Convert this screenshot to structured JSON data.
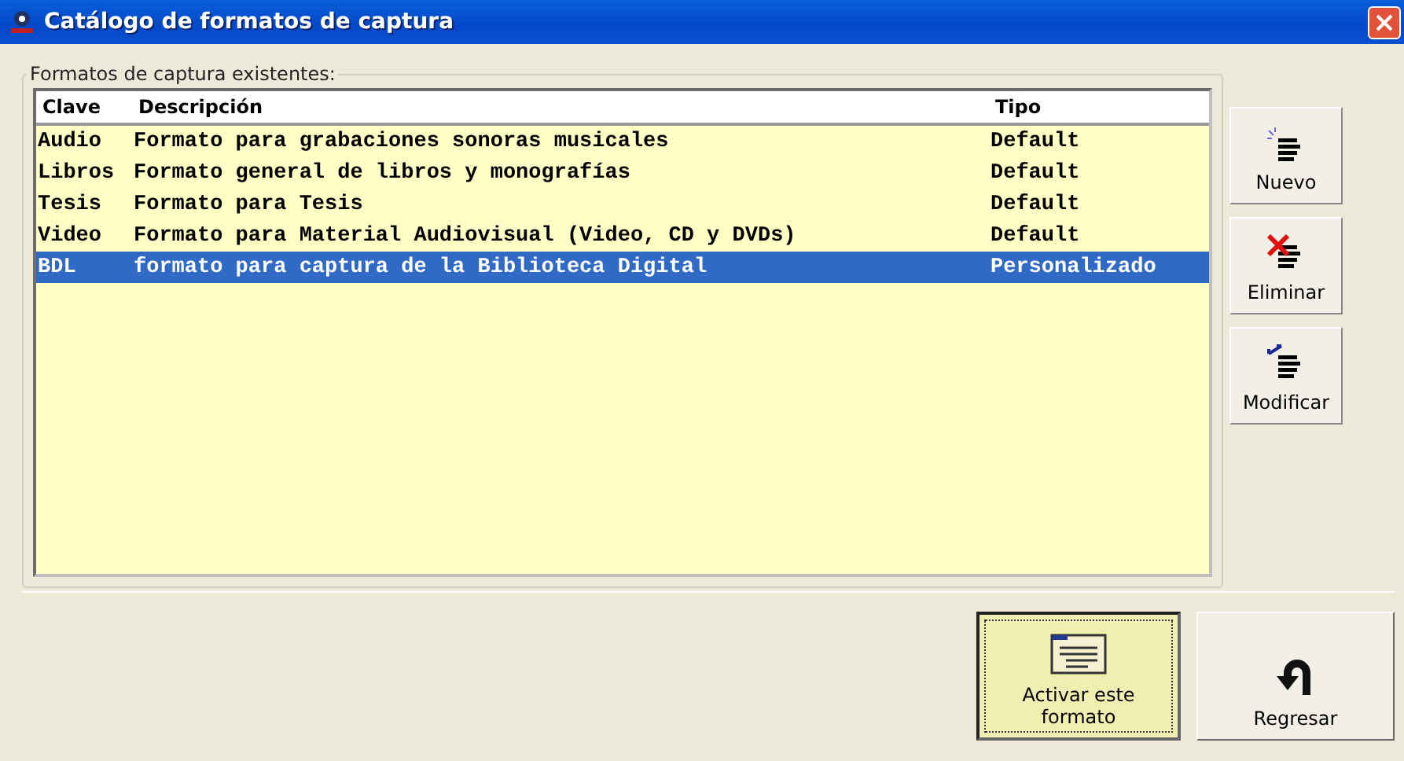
{
  "window": {
    "title": "Catálogo de formatos de captura"
  },
  "group": {
    "label": "Formatos de captura existentes:"
  },
  "table": {
    "columns": [
      "Clave",
      "Descripción",
      "Tipo"
    ],
    "rows": [
      {
        "cells": [
          "Audio",
          "Formato para grabaciones sonoras musicales",
          "Default"
        ],
        "selected": false
      },
      {
        "cells": [
          "Libros",
          "Formato general de libros y monografías",
          "Default"
        ],
        "selected": false
      },
      {
        "cells": [
          "Tesis",
          "Formato para Tesis",
          "Default"
        ],
        "selected": false
      },
      {
        "cells": [
          "Video",
          "Formato para Material Audiovisual (Video, CD y DVDs)",
          "Default"
        ],
        "selected": false
      },
      {
        "cells": [
          "BDL",
          "formato para captura de la Biblioteca Digital",
          "Personalizado"
        ],
        "selected": true
      }
    ]
  },
  "side_buttons": [
    {
      "label": "Nuevo",
      "kind": "new"
    },
    {
      "label": "Eliminar",
      "kind": "delete"
    },
    {
      "label": "Modificar",
      "kind": "modify"
    }
  ],
  "bottom_buttons": [
    {
      "label": "Activar este formato",
      "kind": "activate",
      "focused": true
    },
    {
      "label": "Regresar",
      "kind": "back",
      "focused": false
    }
  ]
}
